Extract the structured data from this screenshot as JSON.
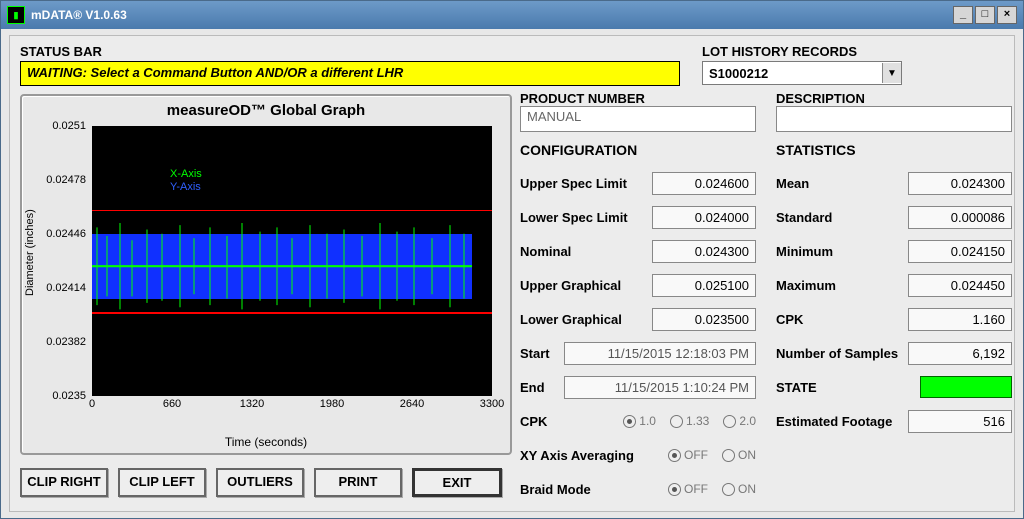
{
  "window": {
    "title": "mDATA® V1.0.63"
  },
  "status": {
    "label": "STATUS BAR",
    "message": "WAITING: Select a Command Button AND/OR a different LHR"
  },
  "lhr": {
    "label": "LOT HISTORY RECORDS",
    "selected": "S1000212"
  },
  "product": {
    "label": "PRODUCT NUMBER",
    "value": "MANUAL"
  },
  "description": {
    "label": "DESCRIPTION",
    "value": ""
  },
  "graph": {
    "title": "measureOD™ Global Graph",
    "ylabel": "Diameter (inches)",
    "xlabel": "Time (seconds)",
    "legend_x": "X-Axis",
    "legend_y": "Y-Axis"
  },
  "chart_data": {
    "type": "line",
    "title": "measureOD™ Global Graph",
    "xlabel": "Time (seconds)",
    "ylabel": "Diameter (inches)",
    "xlim": [
      0,
      3300
    ],
    "ylim": [
      0.0235,
      0.0251
    ],
    "xticks": [
      0,
      660,
      1320,
      1980,
      2640,
      3300
    ],
    "yticks": [
      0.0235,
      0.02382,
      0.02414,
      0.02446,
      0.02478,
      0.0251
    ],
    "spec_lines": {
      "upper": 0.0246,
      "lower": 0.024
    },
    "series": [
      {
        "name": "X-Axis",
        "color": "#00ff00",
        "summary": "noisy series oscillating roughly 0.02410–0.02448 over 0–3100 s"
      },
      {
        "name": "Y-Axis",
        "color": "#1030ff",
        "summary": "noisy series oscillating roughly 0.02408–0.02446 over 0–3100 s"
      }
    ]
  },
  "buttons": {
    "clip_right": "CLIP RIGHT",
    "clip_left": "CLIP LEFT",
    "outliers": "OUTLIERS",
    "print": "PRINT",
    "exit": "EXIT"
  },
  "config": {
    "title": "CONFIGURATION",
    "upper_spec": {
      "label": "Upper Spec Limit",
      "value": "0.024600"
    },
    "lower_spec": {
      "label": "Lower Spec Limit",
      "value": "0.024000"
    },
    "nominal": {
      "label": "Nominal",
      "value": "0.024300"
    },
    "upper_graph": {
      "label": "Upper Graphical",
      "value": "0.025100"
    },
    "lower_graph": {
      "label": "Lower Graphical",
      "value": "0.023500"
    },
    "start": {
      "label": "Start",
      "value": "11/15/2015 12:18:03 PM"
    },
    "end": {
      "label": "End",
      "value": "11/15/2015 1:10:24 PM"
    },
    "cpk_sel": {
      "label": "CPK",
      "options": [
        "1.0",
        "1.33",
        "2.0"
      ],
      "selected": "1.0"
    },
    "xy_avg": {
      "label": "XY Axis Averaging",
      "options": [
        "OFF",
        "ON"
      ],
      "selected": "OFF"
    },
    "braid": {
      "label": "Braid Mode",
      "options": [
        "OFF",
        "ON"
      ],
      "selected": "OFF"
    }
  },
  "stats": {
    "title": "STATISTICS",
    "mean": {
      "label": "Mean",
      "value": "0.024300"
    },
    "std": {
      "label": "Standard",
      "value": "0.000086"
    },
    "min": {
      "label": "Minimum",
      "value": "0.024150"
    },
    "max": {
      "label": "Maximum",
      "value": "0.024450"
    },
    "cpk": {
      "label": "CPK",
      "value": "1.160"
    },
    "samples": {
      "label": "Number of Samples",
      "value": "6,192"
    },
    "state": {
      "label": "STATE"
    },
    "footage": {
      "label": "Estimated Footage",
      "value": "516"
    }
  }
}
